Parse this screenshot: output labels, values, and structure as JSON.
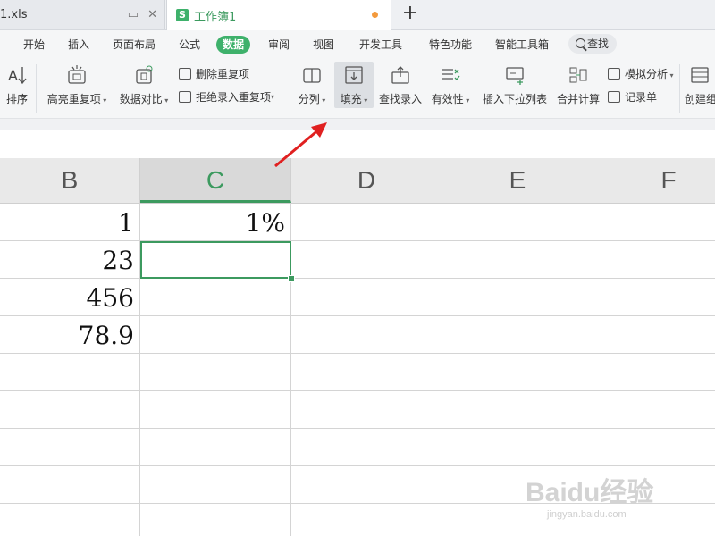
{
  "tabs": [
    {
      "label": "1.xls"
    },
    {
      "label": "工作簿1",
      "logo": "S"
    }
  ],
  "menu": {
    "items": [
      "开始",
      "插入",
      "页面布局",
      "公式",
      "数据",
      "审阅",
      "视图",
      "开发工具",
      "特色功能",
      "智能工具箱"
    ],
    "active": "数据",
    "search_label": "查找"
  },
  "ribbon": {
    "sort": "排序",
    "highlight_dup": "高亮重复项",
    "compare": "数据对比",
    "remove_dup": "删除重复项",
    "reject_dup": "拒绝录入重复项",
    "split": "分列",
    "fill": "填充",
    "lookup_entry": "查找录入",
    "validity": "有效性",
    "insert_dropdown": "插入下拉列表",
    "merge_calc": "合并计算",
    "simulation": "模拟分析",
    "record_form": "记录单",
    "create_group": "创建组"
  },
  "grid": {
    "columns": [
      "B",
      "C",
      "D",
      "E",
      "F"
    ],
    "selected_column": "C",
    "cells": {
      "B1": "1",
      "B2": "23",
      "B3": "456",
      "B4": "78.9",
      "C1": "1%"
    }
  },
  "watermark": {
    "main": "Baidu经验",
    "sub": "jingyan.baidu.com"
  },
  "colors": {
    "accent": "#3c9a5f",
    "arrow": "#e02020",
    "modified_dot": "#f39a3d"
  }
}
